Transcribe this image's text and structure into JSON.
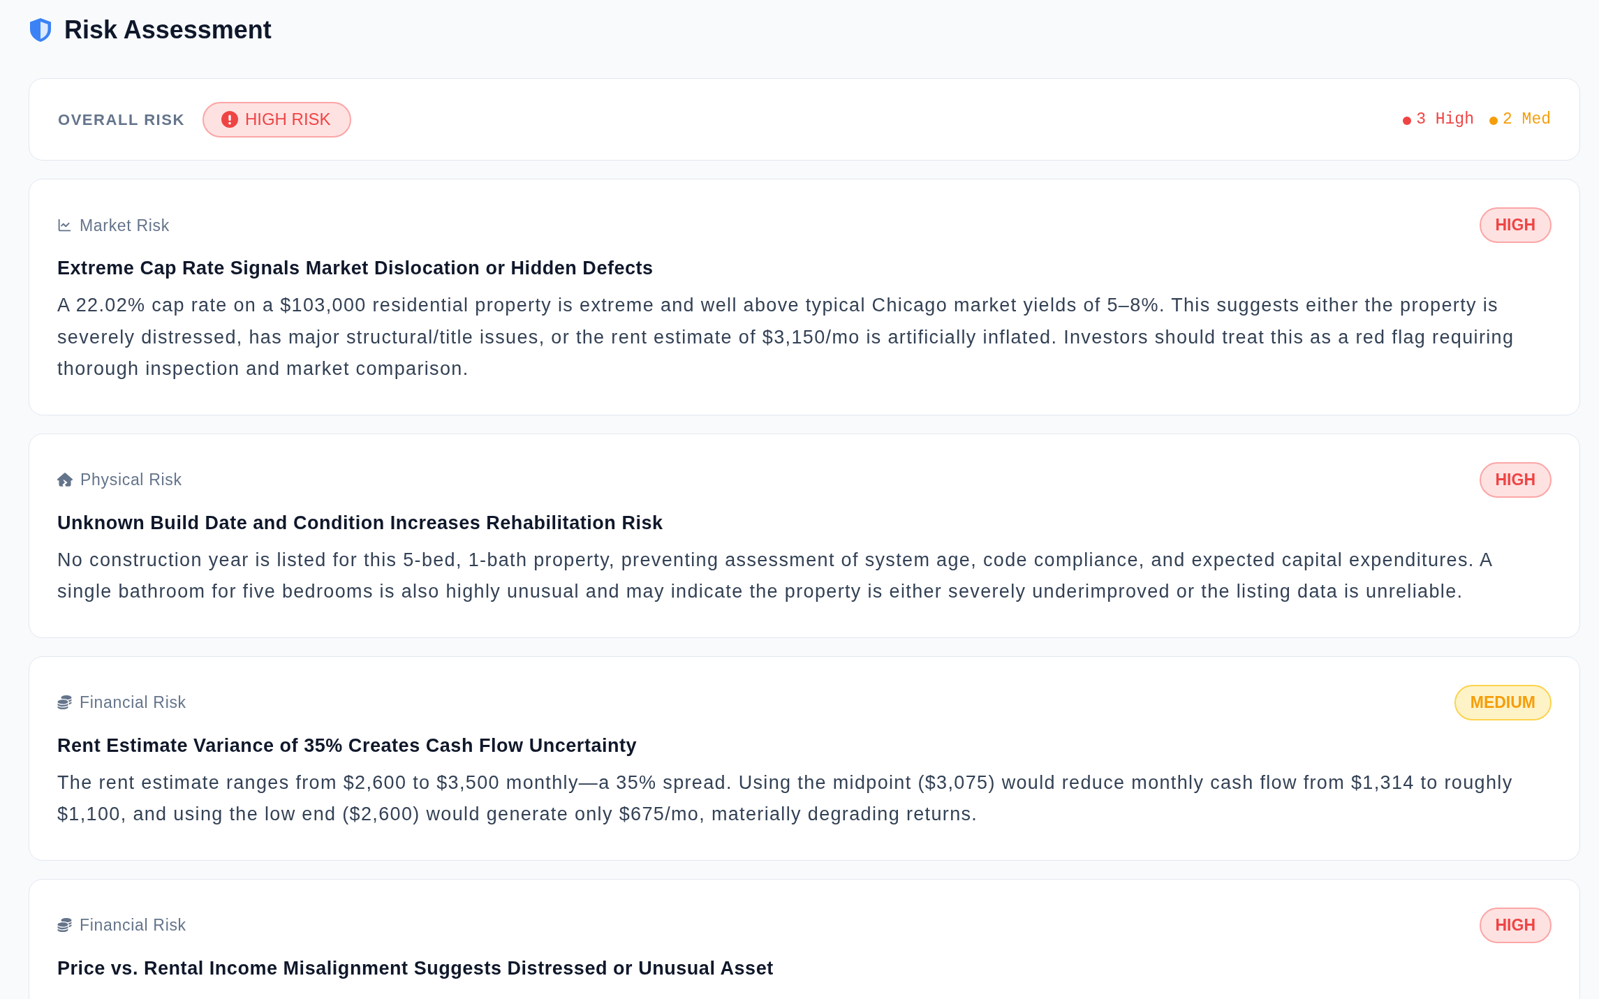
{
  "header": {
    "title": "Risk Assessment"
  },
  "overall": {
    "label": "OVERALL RISK",
    "badge": {
      "text": "HIGH RISK",
      "kind": "high"
    },
    "counts": [
      {
        "text": "3 High",
        "color": "#ef4444"
      },
      {
        "text": "2 Med",
        "color": "#f59e0b"
      }
    ]
  },
  "risks": [
    {
      "category": {
        "text": "Market Risk",
        "kind": "market"
      },
      "badge": {
        "text": "HIGH",
        "kind": "high"
      },
      "title": "Extreme Cap Rate Signals Market Dislocation or Hidden Defects",
      "body": "A 22.02% cap rate on a $103,000 residential property is extreme and well above typical Chicago market yields of 5–8%. This suggests either the property is severely distressed, has major structural/title issues, or the rent estimate of $3,150/mo is artificially inflated. Investors should treat this as a red flag requiring thorough inspection and market comparison."
    },
    {
      "category": {
        "text": "Physical Risk",
        "kind": "physical"
      },
      "badge": {
        "text": "HIGH",
        "kind": "high"
      },
      "title": "Unknown Build Date and Condition Increases Rehabilitation Risk",
      "body": "No construction year is listed for this 5-bed, 1-bath property, preventing assessment of system age, code compliance, and expected capital expenditures. A single bathroom for five bedrooms is also highly unusual and may indicate the property is either severely underimproved or the listing data is unreliable."
    },
    {
      "category": {
        "text": "Financial Risk",
        "kind": "financial"
      },
      "badge": {
        "text": "MEDIUM",
        "kind": "medium"
      },
      "title": "Rent Estimate Variance of 35% Creates Cash Flow Uncertainty",
      "body": "The rent estimate ranges from $2,600 to $3,500 monthly—a 35% spread. Using the midpoint ($3,075) would reduce monthly cash flow from $1,314 to roughly $1,100, and using the low end ($2,600) would generate only $675/mo, materially degrading returns."
    },
    {
      "category": {
        "text": "Financial Risk",
        "kind": "financial"
      },
      "badge": {
        "text": "HIGH",
        "kind": "high"
      },
      "title": "Price vs. Rental Income Misalignment Suggests Distressed or Unusual Asset"
    }
  ]
}
